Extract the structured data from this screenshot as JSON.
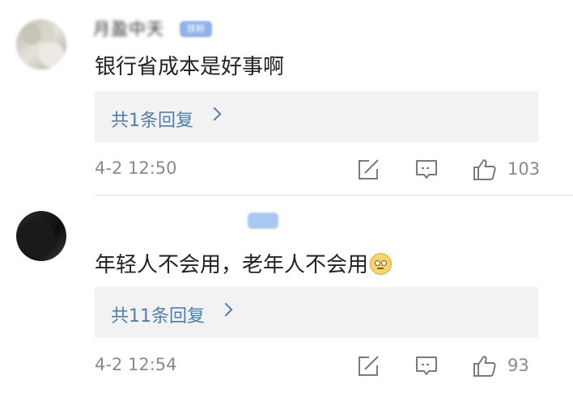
{
  "comments": [
    {
      "username": "月盈中天",
      "badge": "铁粉",
      "text": "银行省成本是好事啊",
      "replies_label": "共1条回复",
      "timestamp": "4-2 12:50",
      "like_count": "103"
    },
    {
      "username": "",
      "badge": "",
      "text": "年轻人不会用，老年人不会用",
      "emoji": "疑问",
      "replies_label": "共11条回复",
      "timestamp": "4-2 12:54",
      "like_count": "93"
    }
  ],
  "colors": {
    "link": "#507daf",
    "meta": "#8a8a8a",
    "reply_bg": "#f2f2f2",
    "text": "#222222"
  },
  "icons": {
    "share": "share-icon",
    "comment": "comment-icon",
    "like": "thumbs-up-icon"
  }
}
